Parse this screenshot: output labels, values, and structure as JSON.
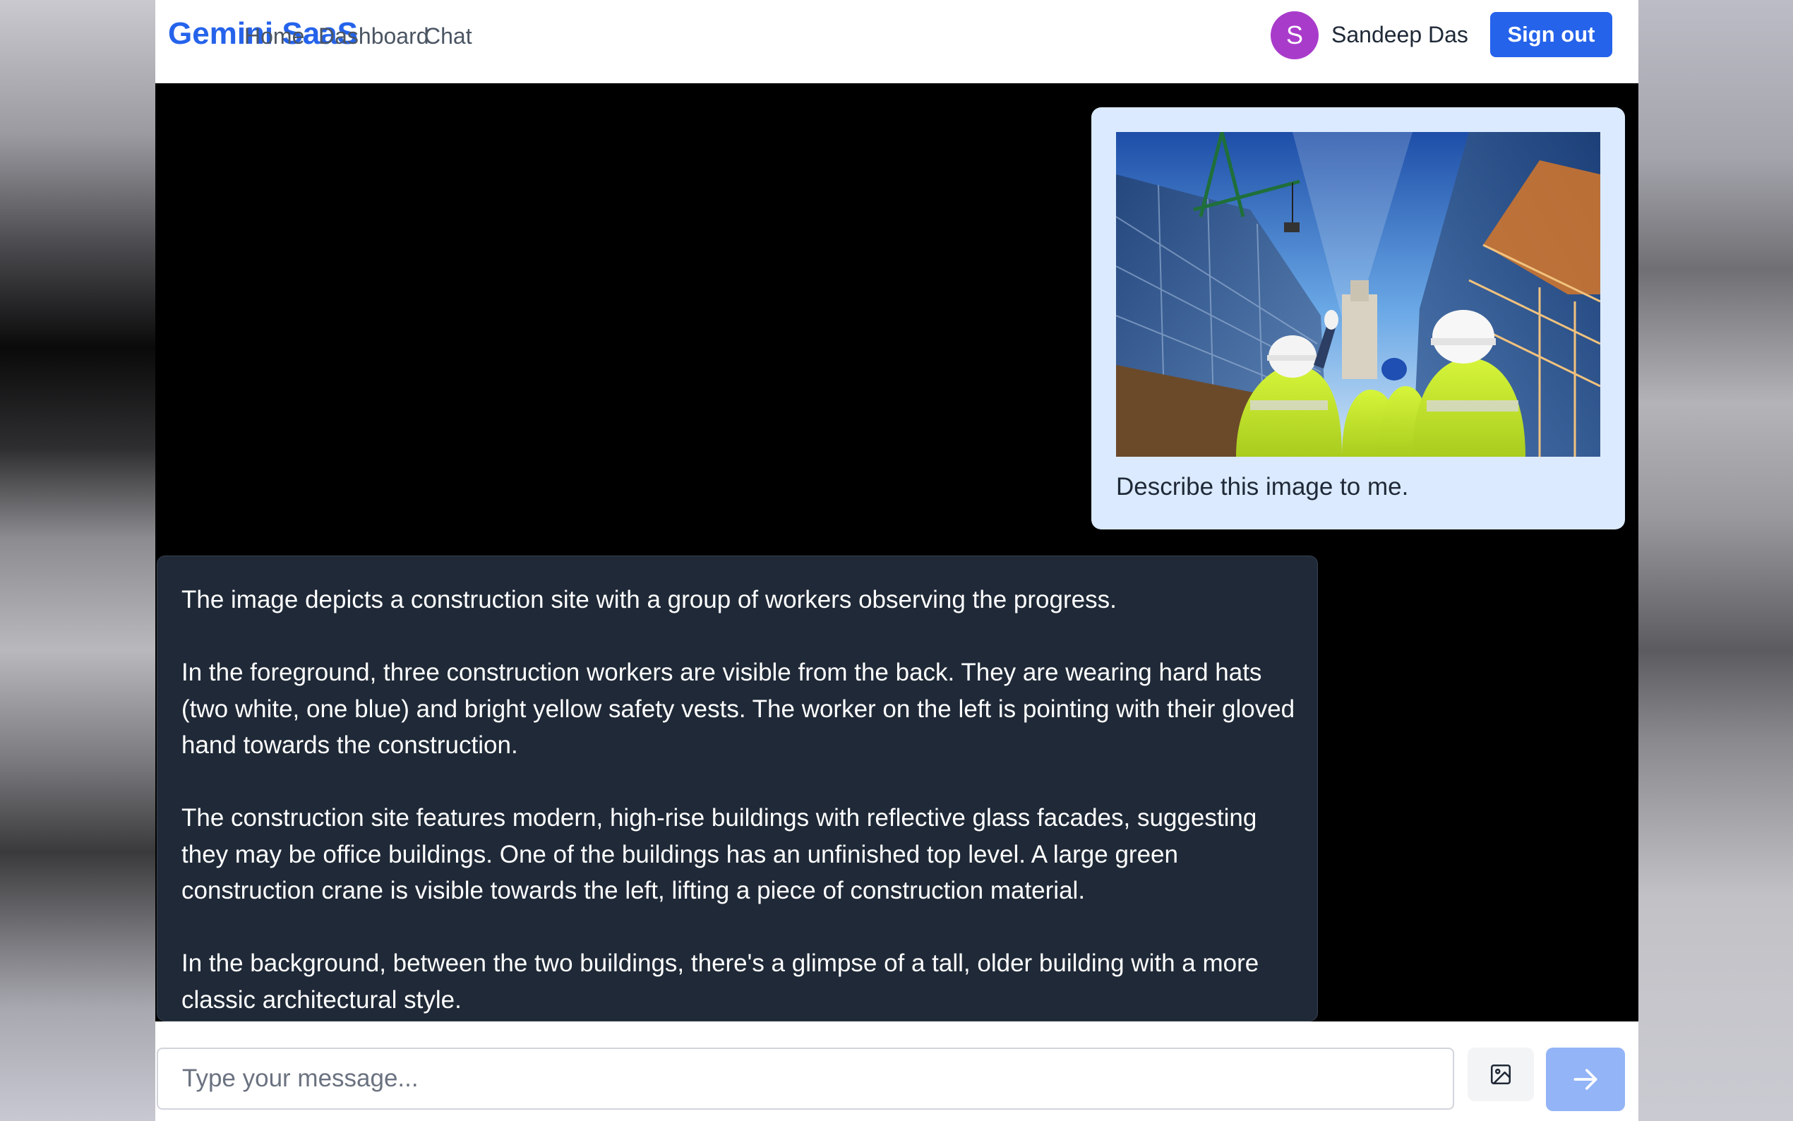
{
  "nav": {
    "brand": "Gemini SaaS",
    "links": [
      "Home",
      "Dashboard",
      "Chat"
    ],
    "user": {
      "initial": "S",
      "name": "Sandeep Das"
    },
    "sign_out_label": "Sign out"
  },
  "chat": {
    "user_message": {
      "image_subject": "construction-site-photo",
      "text": "Describe this image to me."
    },
    "bot_message": {
      "paragraphs": [
        "The image depicts a construction site with a group of workers observing the progress.",
        "In the foreground, three construction workers are visible from the back. They are wearing hard hats (two white, one blue) and bright yellow safety vests. The worker on the left is pointing with their gloved hand towards the construction.",
        "The construction site features modern, high-rise buildings with reflective glass facades, suggesting they may be office buildings. One of the buildings has an unfinished top level. A large green construction crane is visible towards the left, lifting a piece of construction material.",
        "In the background, between the two buildings, there's a glimpse of a tall, older building with a more classic architectural style."
      ]
    }
  },
  "composer": {
    "placeholder": "Type your message...",
    "value": "",
    "image_button_icon": "image-icon",
    "send_button_icon": "arrow-right-icon"
  },
  "colors": {
    "brand": "#2563eb",
    "avatar": "#a93bcb",
    "user_bubble": "#dbeafe",
    "bot_bubble": "#1f2937",
    "send_button": "#93b4f7"
  }
}
